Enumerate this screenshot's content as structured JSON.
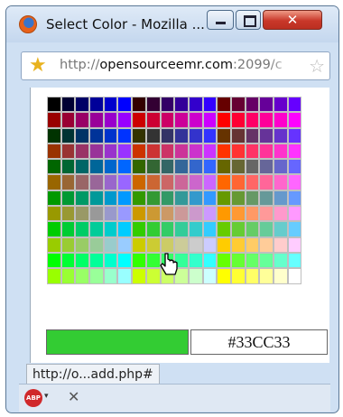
{
  "window": {
    "title": "Select Color - Mozilla ...",
    "close_glyph": "✕",
    "icon": "firefox-icon"
  },
  "address_bar": {
    "url_prefix": "http://",
    "url_host": "opensourceemr.com",
    "url_rest": ":2099/c",
    "star_glyph": "★",
    "bookmark_glyph": "☆"
  },
  "picker": {
    "rows": [
      [
        "#000000",
        "#000033",
        "#000066",
        "#000099",
        "#0000cc",
        "#0000ff",
        "#330000",
        "#330033",
        "#330066",
        "#330099",
        "#3300cc",
        "#3300ff",
        "#660000",
        "#660033",
        "#660066",
        "#660099",
        "#6600cc",
        "#6600ff"
      ],
      [
        "#990000",
        "#990033",
        "#990066",
        "#990099",
        "#9900cc",
        "#9900ff",
        "#cc0000",
        "#cc0033",
        "#cc0066",
        "#cc0099",
        "#cc00cc",
        "#cc00ff",
        "#ff0000",
        "#ff0033",
        "#ff0066",
        "#ff0099",
        "#ff00cc",
        "#ff00ff"
      ],
      [
        "#003300",
        "#003333",
        "#003366",
        "#003399",
        "#0033cc",
        "#0033ff",
        "#333300",
        "#333333",
        "#333366",
        "#333399",
        "#3333cc",
        "#3333ff",
        "#663300",
        "#663333",
        "#663366",
        "#663399",
        "#6633cc",
        "#6633ff"
      ],
      [
        "#993300",
        "#993333",
        "#993366",
        "#993399",
        "#9933cc",
        "#9933ff",
        "#cc3300",
        "#cc3333",
        "#cc3366",
        "#cc3399",
        "#cc33cc",
        "#cc33ff",
        "#ff3300",
        "#ff3333",
        "#ff3366",
        "#ff3399",
        "#ff33cc",
        "#ff33ff"
      ],
      [
        "#006600",
        "#006633",
        "#006666",
        "#006699",
        "#0066cc",
        "#0066ff",
        "#336600",
        "#336633",
        "#336666",
        "#336699",
        "#3366cc",
        "#3366ff",
        "#666600",
        "#666633",
        "#666666",
        "#666699",
        "#6666cc",
        "#6666ff"
      ],
      [
        "#996600",
        "#996633",
        "#996666",
        "#996699",
        "#9966cc",
        "#9966ff",
        "#cc6600",
        "#cc6633",
        "#cc6666",
        "#cc6699",
        "#cc66cc",
        "#cc66ff",
        "#ff6600",
        "#ff6633",
        "#ff6666",
        "#ff6699",
        "#ff66cc",
        "#ff66ff"
      ],
      [
        "#009900",
        "#009933",
        "#009966",
        "#009999",
        "#0099cc",
        "#0099ff",
        "#339900",
        "#339933",
        "#339966",
        "#339999",
        "#3399cc",
        "#3399ff",
        "#669900",
        "#669933",
        "#669966",
        "#669999",
        "#6699cc",
        "#6699ff"
      ],
      [
        "#999900",
        "#999933",
        "#999966",
        "#999999",
        "#9999cc",
        "#9999ff",
        "#cc9900",
        "#cc9933",
        "#cc9966",
        "#cc9999",
        "#cc99cc",
        "#cc99ff",
        "#ff9900",
        "#ff9933",
        "#ff9966",
        "#ff9999",
        "#ff99cc",
        "#ff99ff"
      ],
      [
        "#00cc00",
        "#00cc33",
        "#00cc66",
        "#00cc99",
        "#00cccc",
        "#00ccff",
        "#33cc00",
        "#33cc33",
        "#33cc66",
        "#33cc99",
        "#33cccc",
        "#33ccff",
        "#66cc00",
        "#66cc33",
        "#66cc66",
        "#66cc99",
        "#66cccc",
        "#66ccff"
      ],
      [
        "#99cc00",
        "#99cc33",
        "#99cc66",
        "#99cc99",
        "#99cccc",
        "#99ccff",
        "#cccc00",
        "#cccc33",
        "#cccc66",
        "#cccc99",
        "#cccccc",
        "#ccccff",
        "#ffcc00",
        "#ffcc33",
        "#ffcc66",
        "#ffcc99",
        "#ffcccc",
        "#ffccff"
      ],
      [
        "#00ff00",
        "#00ff33",
        "#00ff66",
        "#00ff99",
        "#00ffcc",
        "#00ffff",
        "#33ff00",
        "#33ff33",
        "#33ff66",
        "#33ff99",
        "#33ffcc",
        "#33ffff",
        "#66ff00",
        "#66ff33",
        "#66ff66",
        "#66ff99",
        "#66ffcc",
        "#66ffff"
      ],
      [
        "#99ff00",
        "#99ff33",
        "#99ff66",
        "#99ff99",
        "#99ffcc",
        "#99ffff",
        "#ccff00",
        "#ccff33",
        "#ccff66",
        "#ccff99",
        "#ccffcc",
        "#ccffff",
        "#ffff00",
        "#ffff33",
        "#ffff66",
        "#ffff99",
        "#ffffcc",
        "#ffffff"
      ]
    ],
    "preview_color": "#33CC33",
    "hex_value": "#33CC33",
    "cursor_icon": "hand-pointer-icon"
  },
  "status": {
    "link_text": "http://o...add.php#"
  },
  "addon_bar": {
    "abp_label": "ABP",
    "abp_caret": "▾",
    "close_glyph": "✕"
  }
}
